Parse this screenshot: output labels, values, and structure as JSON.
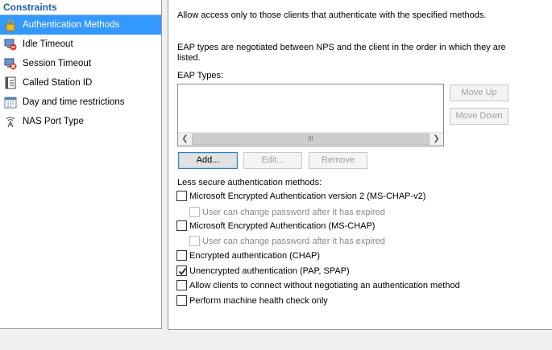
{
  "sidebar": {
    "header": "Constraints",
    "items": [
      {
        "label": "Authentication Methods",
        "icon": "lock-icon"
      },
      {
        "label": "Idle Timeout",
        "icon": "idle-timeout-icon"
      },
      {
        "label": "Session Timeout",
        "icon": "session-timeout-icon"
      },
      {
        "label": "Called Station ID",
        "icon": "phone-book-icon"
      },
      {
        "label": "Day and time restrictions",
        "icon": "calendar-icon"
      },
      {
        "label": "NAS Port Type",
        "icon": "antenna-icon"
      }
    ]
  },
  "main": {
    "intro": "Allow access only to those clients that authenticate with the specified methods.",
    "eap_note": "EAP types are negotiated between NPS and the client in the order in which they are listed.",
    "eap_types_label": "EAP Types:",
    "scroll_thumb_glyph": "III",
    "buttons": {
      "move_up": "Move Up",
      "move_down": "Move Down",
      "add": "Add...",
      "edit": "Edit...",
      "remove": "Remove"
    },
    "less_secure_label": "Less secure authentication methods:",
    "checkboxes": [
      {
        "label": "Microsoft Encrypted Authentication version 2 (MS-CHAP-v2)",
        "checked": false
      },
      {
        "label": "User can change password after it has expired",
        "checked": false,
        "disabled": true
      },
      {
        "label": "Microsoft Encrypted Authentication (MS-CHAP)",
        "checked": false
      },
      {
        "label": "User can change password after it has expired",
        "checked": false,
        "disabled": true
      },
      {
        "label": "Encrypted authentication (CHAP)",
        "checked": false
      },
      {
        "label": "Unencrypted authentication (PAP, SPAP)",
        "checked": true
      },
      {
        "label": "Allow clients to connect without negotiating an authentication method",
        "checked": false
      },
      {
        "label": "Perform machine health check only",
        "checked": false
      }
    ]
  },
  "colors": {
    "selection": "#3399ff",
    "header_text": "#1c5ea8"
  }
}
